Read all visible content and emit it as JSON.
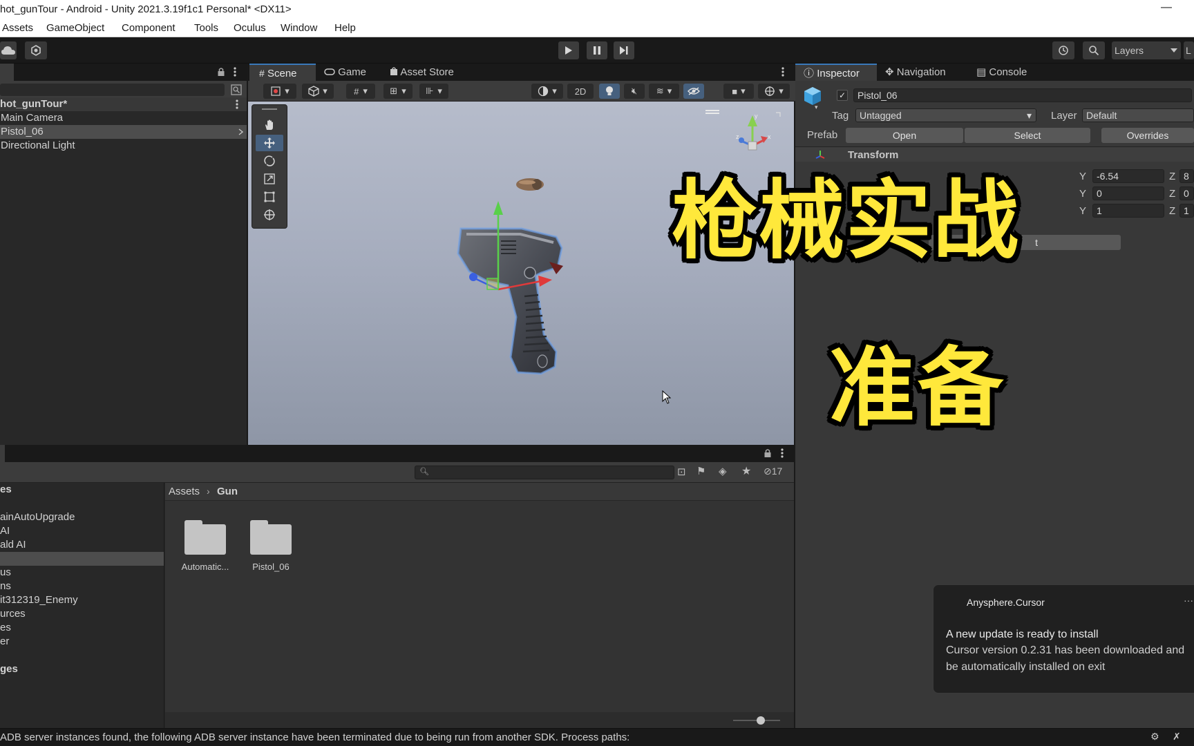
{
  "window": {
    "title": "hot_gunTour - Android - Unity 2021.3.19f1c1 Personal* <DX11>",
    "minimize_glyph": "—"
  },
  "menubar": {
    "items": [
      "Assets",
      "GameObject",
      "Component",
      "Tools",
      "Oculus",
      "Window",
      "Help"
    ]
  },
  "toolbar": {
    "layers_label": "Layers",
    "layout_label": "L"
  },
  "hierarchy": {
    "scene_name": "hot_gunTour*",
    "items": [
      "Main Camera",
      "Pistol_06",
      "Directional Light"
    ],
    "selected_index": 1
  },
  "scene_panel": {
    "tabs": [
      "Scene",
      "Game",
      "Asset Store"
    ],
    "active_tab": "Scene",
    "mode_2d_label": "2D",
    "gizmo_axes": [
      "x",
      "y",
      "z"
    ]
  },
  "inspector": {
    "tabs": [
      "Inspector",
      "Navigation",
      "Console"
    ],
    "object_name": "Pistol_06",
    "active_checked": true,
    "tag_label": "Tag",
    "tag_value": "Untagged",
    "layer_label": "Layer",
    "layer_value": "Default",
    "prefab_label": "Prefab",
    "prefab_open": "Open",
    "prefab_select": "Select",
    "prefab_overrides": "Overrides",
    "transform_label": "Transform",
    "y_label": "Y",
    "z_label": "Z",
    "position": {
      "y": "-6.54",
      "z": "8"
    },
    "rotation": {
      "y": "0",
      "z": "0"
    },
    "scale": {
      "y": "1",
      "z": "1"
    },
    "add_component_fragment": "t"
  },
  "project": {
    "tree": [
      {
        "label": "es",
        "bold": true
      },
      {
        "label": "",
        "bold": false
      },
      {
        "label": "ainAutoUpgrade",
        "bold": false
      },
      {
        "label": "AI",
        "bold": false
      },
      {
        "label": "ald AI",
        "bold": false
      },
      {
        "label": "",
        "bold": false,
        "selected": true
      },
      {
        "label": "us",
        "bold": false
      },
      {
        "label": "ns",
        "bold": false
      },
      {
        "label": "it312319_Enemy",
        "bold": false
      },
      {
        "label": "urces",
        "bold": false
      },
      {
        "label": "es",
        "bold": false
      },
      {
        "label": "er",
        "bold": false
      },
      {
        "label": "",
        "bold": false
      },
      {
        "label": "ges",
        "bold": true
      }
    ],
    "breadcrumb": [
      "Assets",
      "Gun"
    ],
    "folders": [
      "Automatic...",
      "Pistol_06"
    ],
    "hidden_count": "17"
  },
  "status": {
    "message": "ADB server instances found, the following ADB server instance have been terminated due to being run from another SDK. Process paths:"
  },
  "notification": {
    "app": "Anysphere.Cursor",
    "more": "···",
    "heading": "A new update is ready to install",
    "body_line1": "Cursor version 0.2.31 has been downloaded and",
    "body_line2": "be automatically installed on exit"
  },
  "overlay": {
    "caption_line1": "枪械实战",
    "caption_line2": "准备"
  },
  "colors": {
    "caption_yellow": "#ffe83b",
    "selection_blue": "#2c5d87",
    "accent_blue": "#3a79bb"
  }
}
